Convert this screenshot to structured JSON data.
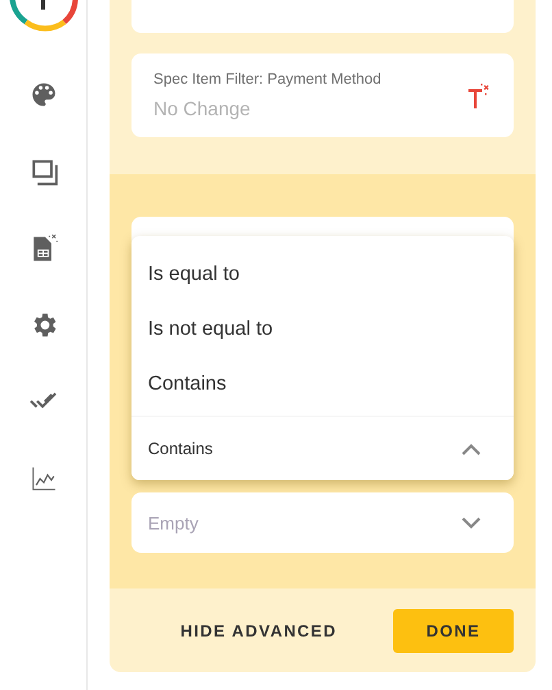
{
  "filters": [
    {
      "label": "Spec Item Filter: Payment Method",
      "placeholder": "No Change"
    }
  ],
  "condition_dropdown": {
    "expanded": true,
    "value": "Contains",
    "options": [
      "Is equal to",
      "Is not equal to",
      "Contains"
    ]
  },
  "value_field": {
    "placeholder": "Empty"
  },
  "actions": [
    {
      "label": "HIDE ADVANCED",
      "kind": "text"
    },
    {
      "label": "DONE",
      "kind": "primary"
    }
  ]
}
